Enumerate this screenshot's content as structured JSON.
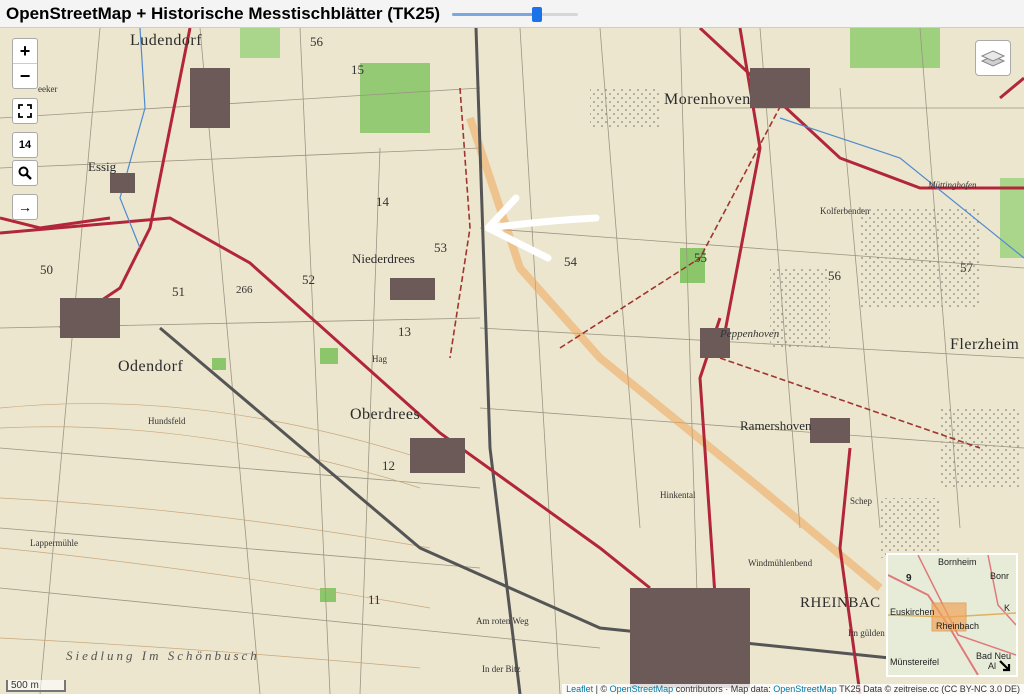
{
  "header": {
    "title": "OpenStreetMap + Historische Messtischblätter (TK25)"
  },
  "opacity_slider": {
    "value_fraction": 0.67
  },
  "controls": {
    "zoom_in": "+",
    "zoom_out": "−",
    "fullscreen_icon": "fullscreen-icon",
    "zoom_level": "14",
    "search_icon": "search-icon",
    "locate_arrow": "→",
    "layers_icon": "layers-icon"
  },
  "places": {
    "ludendorf": "Ludendorf",
    "essig": "Essig",
    "niederdrees": "Niederdrees",
    "odendorf": "Odendorf",
    "oberdrees": "Oberdrees",
    "morenhoven": "Morenhoven",
    "peppenhoven": "Peppenhoven",
    "ramershoven": "Ramershoven",
    "flerzheim": "Flerzheim",
    "rheinbach": "RHEINBAC",
    "hundsfeld": "Hundsfeld",
    "lappermuhle": "Lappermühle",
    "windmuhlenbend": "Windmühlenbend",
    "siedlung": "Siedlung  Im  Schönbusch",
    "hag": "Hag",
    "muttinghofen": "Müttinghofen",
    "kolferbenden": "Kolferbenden",
    "hinkental": "Hinkental",
    "am_roten_weg": "Am roten Weg",
    "in_der_bitz": "In der Bitz",
    "im_gulden": "Im gülden",
    "schep": "Schep",
    "eeker": "eeker"
  },
  "grid_numbers": [
    "56",
    "15",
    "14",
    "53",
    "54",
    "55",
    "56",
    "57",
    "50",
    "51",
    "52",
    "13",
    "12",
    "11",
    "266"
  ],
  "minimap": {
    "bornheim": "Bornheim",
    "bonn": "Bonr",
    "euskirchen": "Euskirchen",
    "rheinbach": "Rheinbach",
    "bad_munstereifel": "Münstereifel",
    "bad_neu": "Bad Neu",
    "al": "Al",
    "k": "K",
    "road_number": "9"
  },
  "scale": {
    "label": "500 m"
  },
  "attribution": {
    "leaflet": "Leaflet",
    "sep1": " | © ",
    "osm": "OpenStreetMap",
    "contributors": " contributors · Map data: ",
    "osm2": "OpenStreetMap",
    "tk25": " TK25 Data © zeitreise.cc (CC BY-NC 3.0 DE)"
  },
  "colors": {
    "accent": "#1a73e8",
    "paper": "#ece6cf",
    "road": "#b2263a",
    "highlight": "#f0a65a"
  }
}
